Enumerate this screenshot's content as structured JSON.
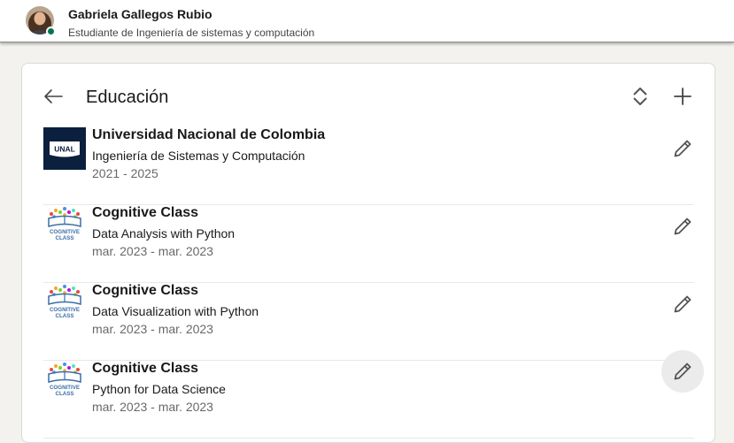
{
  "profile": {
    "name": "Gabriela Gallegos Rubio",
    "headline": "Estudiante de Ingeniería de sistemas y computación",
    "presence_color": "#01754f"
  },
  "section": {
    "title": "Educación",
    "back_icon": "arrow-left-icon",
    "reorder_icon": "reorder-icon",
    "add_icon": "plus-icon"
  },
  "education": [
    {
      "school": "Universidad Nacional de Colombia",
      "degree": "Ingeniería de Sistemas y Computación",
      "dates": "2021 - 2025",
      "logo": "unal-logo",
      "logo_text": "UNAL",
      "logo_color": "#0b1f3f"
    },
    {
      "school": "Cognitive Class",
      "degree": "Data Analysis with Python",
      "dates": "mar. 2023 - mar. 2023",
      "logo": "cognitive-class-logo",
      "logo_text": "COGNITIVE CLASS"
    },
    {
      "school": "Cognitive Class",
      "degree": "Data Visualization with Python",
      "dates": "mar. 2023 - mar. 2023",
      "logo": "cognitive-class-logo",
      "logo_text": "COGNITIVE CLASS"
    },
    {
      "school": "Cognitive Class",
      "degree": "Python for Data Science",
      "dates": "mar. 2023 - mar. 2023",
      "logo": "cognitive-class-logo",
      "logo_text": "COGNITIVE CLASS"
    }
  ],
  "colors": {
    "page_bg": "#f4f2ee",
    "card_bg": "#ffffff",
    "icon": "#5e5e5e",
    "cc_blue": "#3b6ea5"
  }
}
